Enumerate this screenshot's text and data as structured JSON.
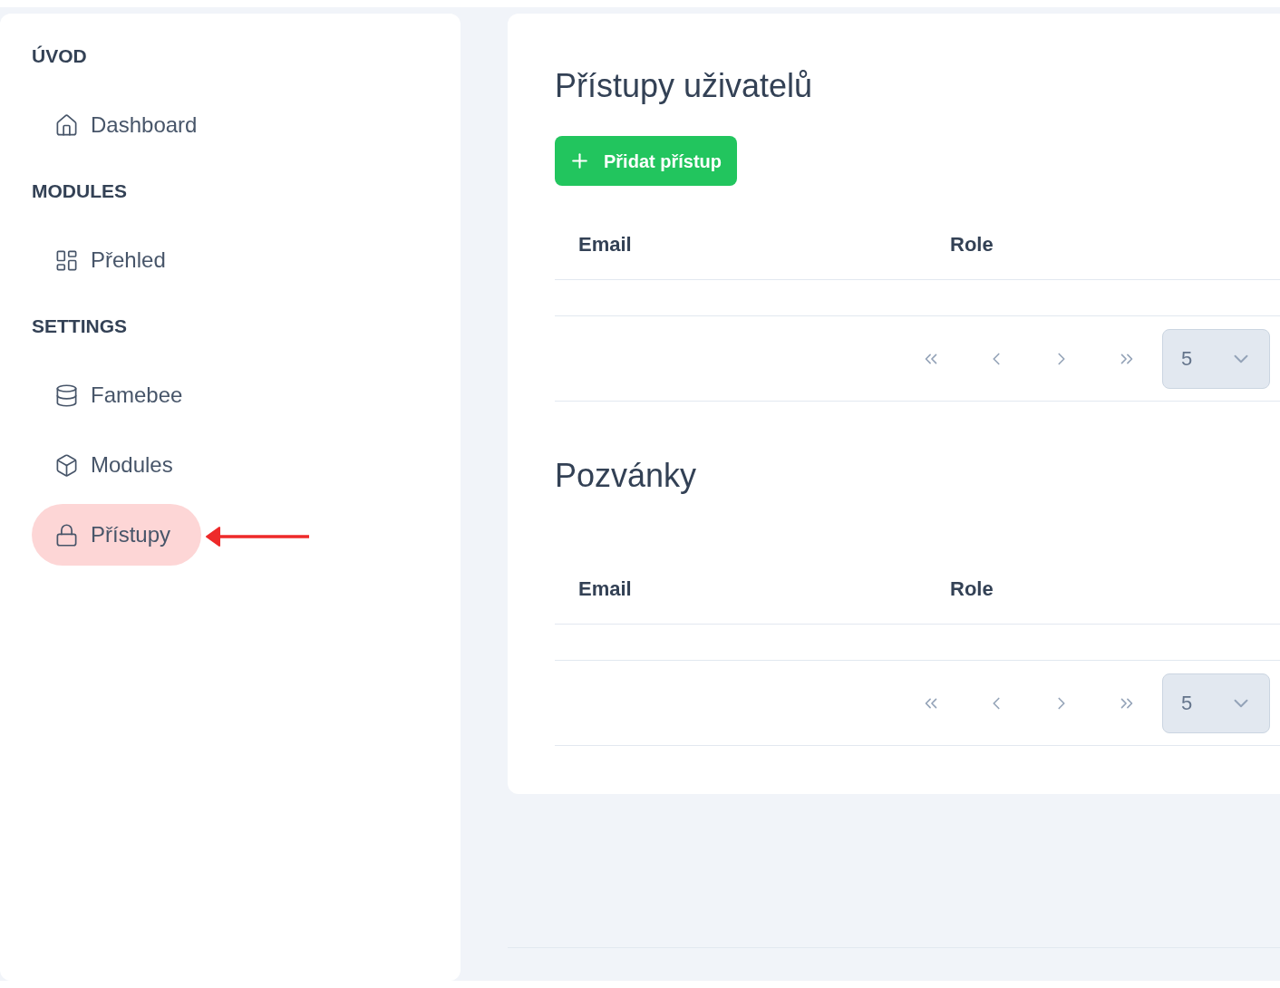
{
  "sidebar": {
    "sections": [
      {
        "heading": "ÚVOD",
        "items": [
          {
            "label": "Dashboard",
            "selected": false
          }
        ]
      },
      {
        "heading": "MODULES",
        "items": [
          {
            "label": "Přehled",
            "selected": false
          }
        ]
      },
      {
        "heading": "SETTINGS",
        "items": [
          {
            "label": "Famebee",
            "selected": false
          },
          {
            "label": "Modules",
            "selected": false
          },
          {
            "label": "Přístupy",
            "selected": true
          }
        ]
      }
    ]
  },
  "main": {
    "sections": [
      {
        "title": "Přístupy uživatelů",
        "button": "Přidat přístup",
        "table": {
          "columns": [
            "Email",
            "Role"
          ],
          "page_size": "5"
        }
      },
      {
        "title": "Pozvánky",
        "table": {
          "columns": [
            "Email",
            "Role"
          ],
          "page_size": "5"
        }
      }
    ]
  }
}
